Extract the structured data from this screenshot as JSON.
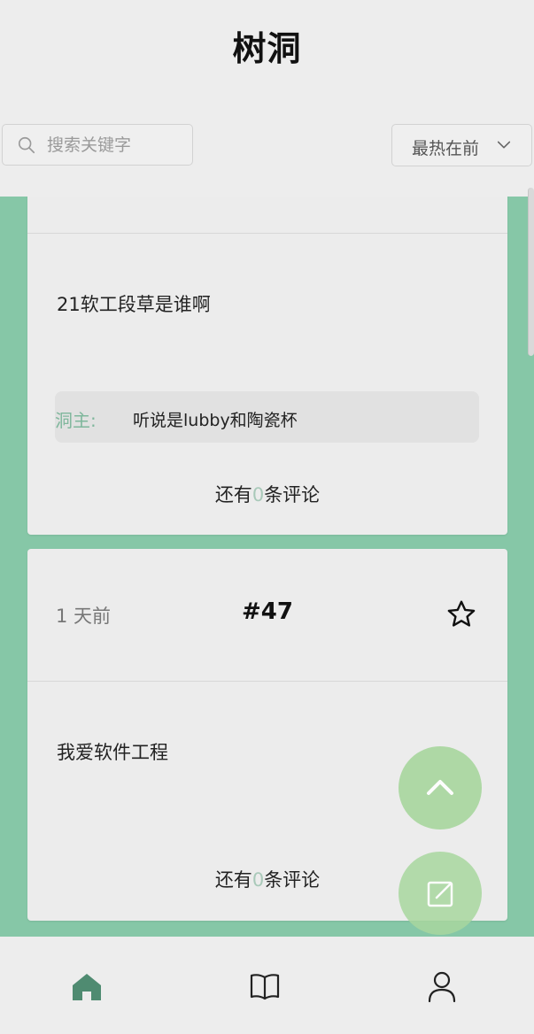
{
  "header": {
    "title": "树洞"
  },
  "search": {
    "placeholder": "搜索关键字"
  },
  "sort": {
    "selected": "最热在前"
  },
  "posts": [
    {
      "text": "21软工段草是谁啊",
      "reply": {
        "author": "洞主:",
        "text": "听说是lubby和陶瓷杯"
      },
      "more_prefix": "还有",
      "more_count": "0",
      "more_suffix": "条评论"
    },
    {
      "time": "1 天前",
      "id": "#47",
      "text": "我爱软件工程",
      "more_prefix": "还有",
      "more_count": "0",
      "more_suffix": "条评论"
    }
  ],
  "tabbar": {
    "items": [
      "home-icon",
      "book-icon",
      "user-icon"
    ],
    "active": "home-icon"
  },
  "colors": {
    "accent": "#86c7a7",
    "fab": "#a9d79f",
    "active_tab": "#4f8b71"
  }
}
